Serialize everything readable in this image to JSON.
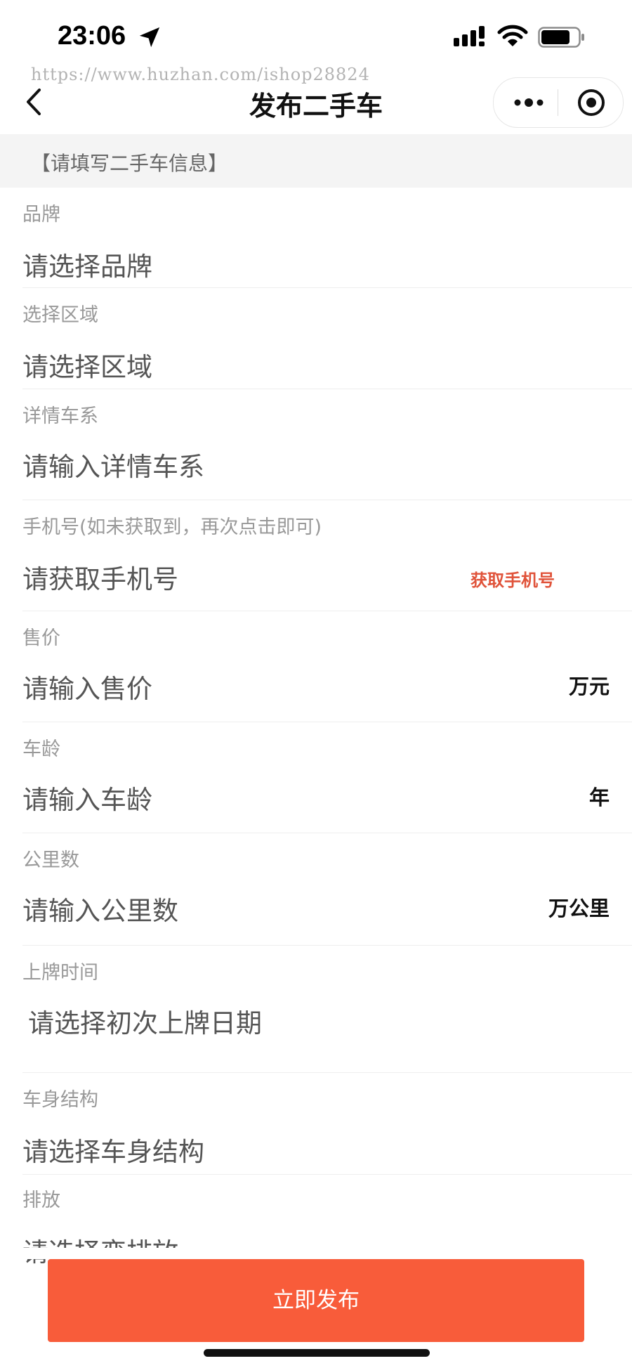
{
  "status_bar": {
    "time": "23:06",
    "icons": [
      "location-arrow-icon",
      "cellular-signal-icon",
      "wifi-icon",
      "battery-icon"
    ]
  },
  "watermark": "https://www.huzhan.com/ishop28824",
  "nav": {
    "title": "发布二手车",
    "back_icon": "chevron-left-icon",
    "more_icon": "more-dots-icon",
    "close_icon": "target-close-icon"
  },
  "section_header": "【请填写二手车信息】",
  "fields": [
    {
      "label": "品牌",
      "placeholder": "请选择品牌"
    },
    {
      "label": "选择区域",
      "placeholder": "请选择区域"
    },
    {
      "label": "详情车系",
      "placeholder": "请输入详情车系"
    },
    {
      "label": "手机号(如未获取到，再次点击即可)",
      "placeholder": "请获取手机号",
      "action": "获取手机号"
    },
    {
      "label": "售价",
      "placeholder": "请输入售价",
      "unit": "万元"
    },
    {
      "label": "车龄",
      "placeholder": "请输入车龄",
      "unit": "年"
    },
    {
      "label": "公里数",
      "placeholder": "请输入公里数",
      "unit": "万公里"
    },
    {
      "label": "上牌时间",
      "placeholder": "请选择初次上牌日期"
    },
    {
      "label": "车身结构",
      "placeholder": "请选择车身结构"
    },
    {
      "label": "排放",
      "placeholder": "请选择变排放"
    }
  ],
  "submit_label": "立即发布",
  "colors": {
    "accent": "#f85c3a",
    "action_text": "#e0533a",
    "section_bg": "#f4f4f4"
  }
}
